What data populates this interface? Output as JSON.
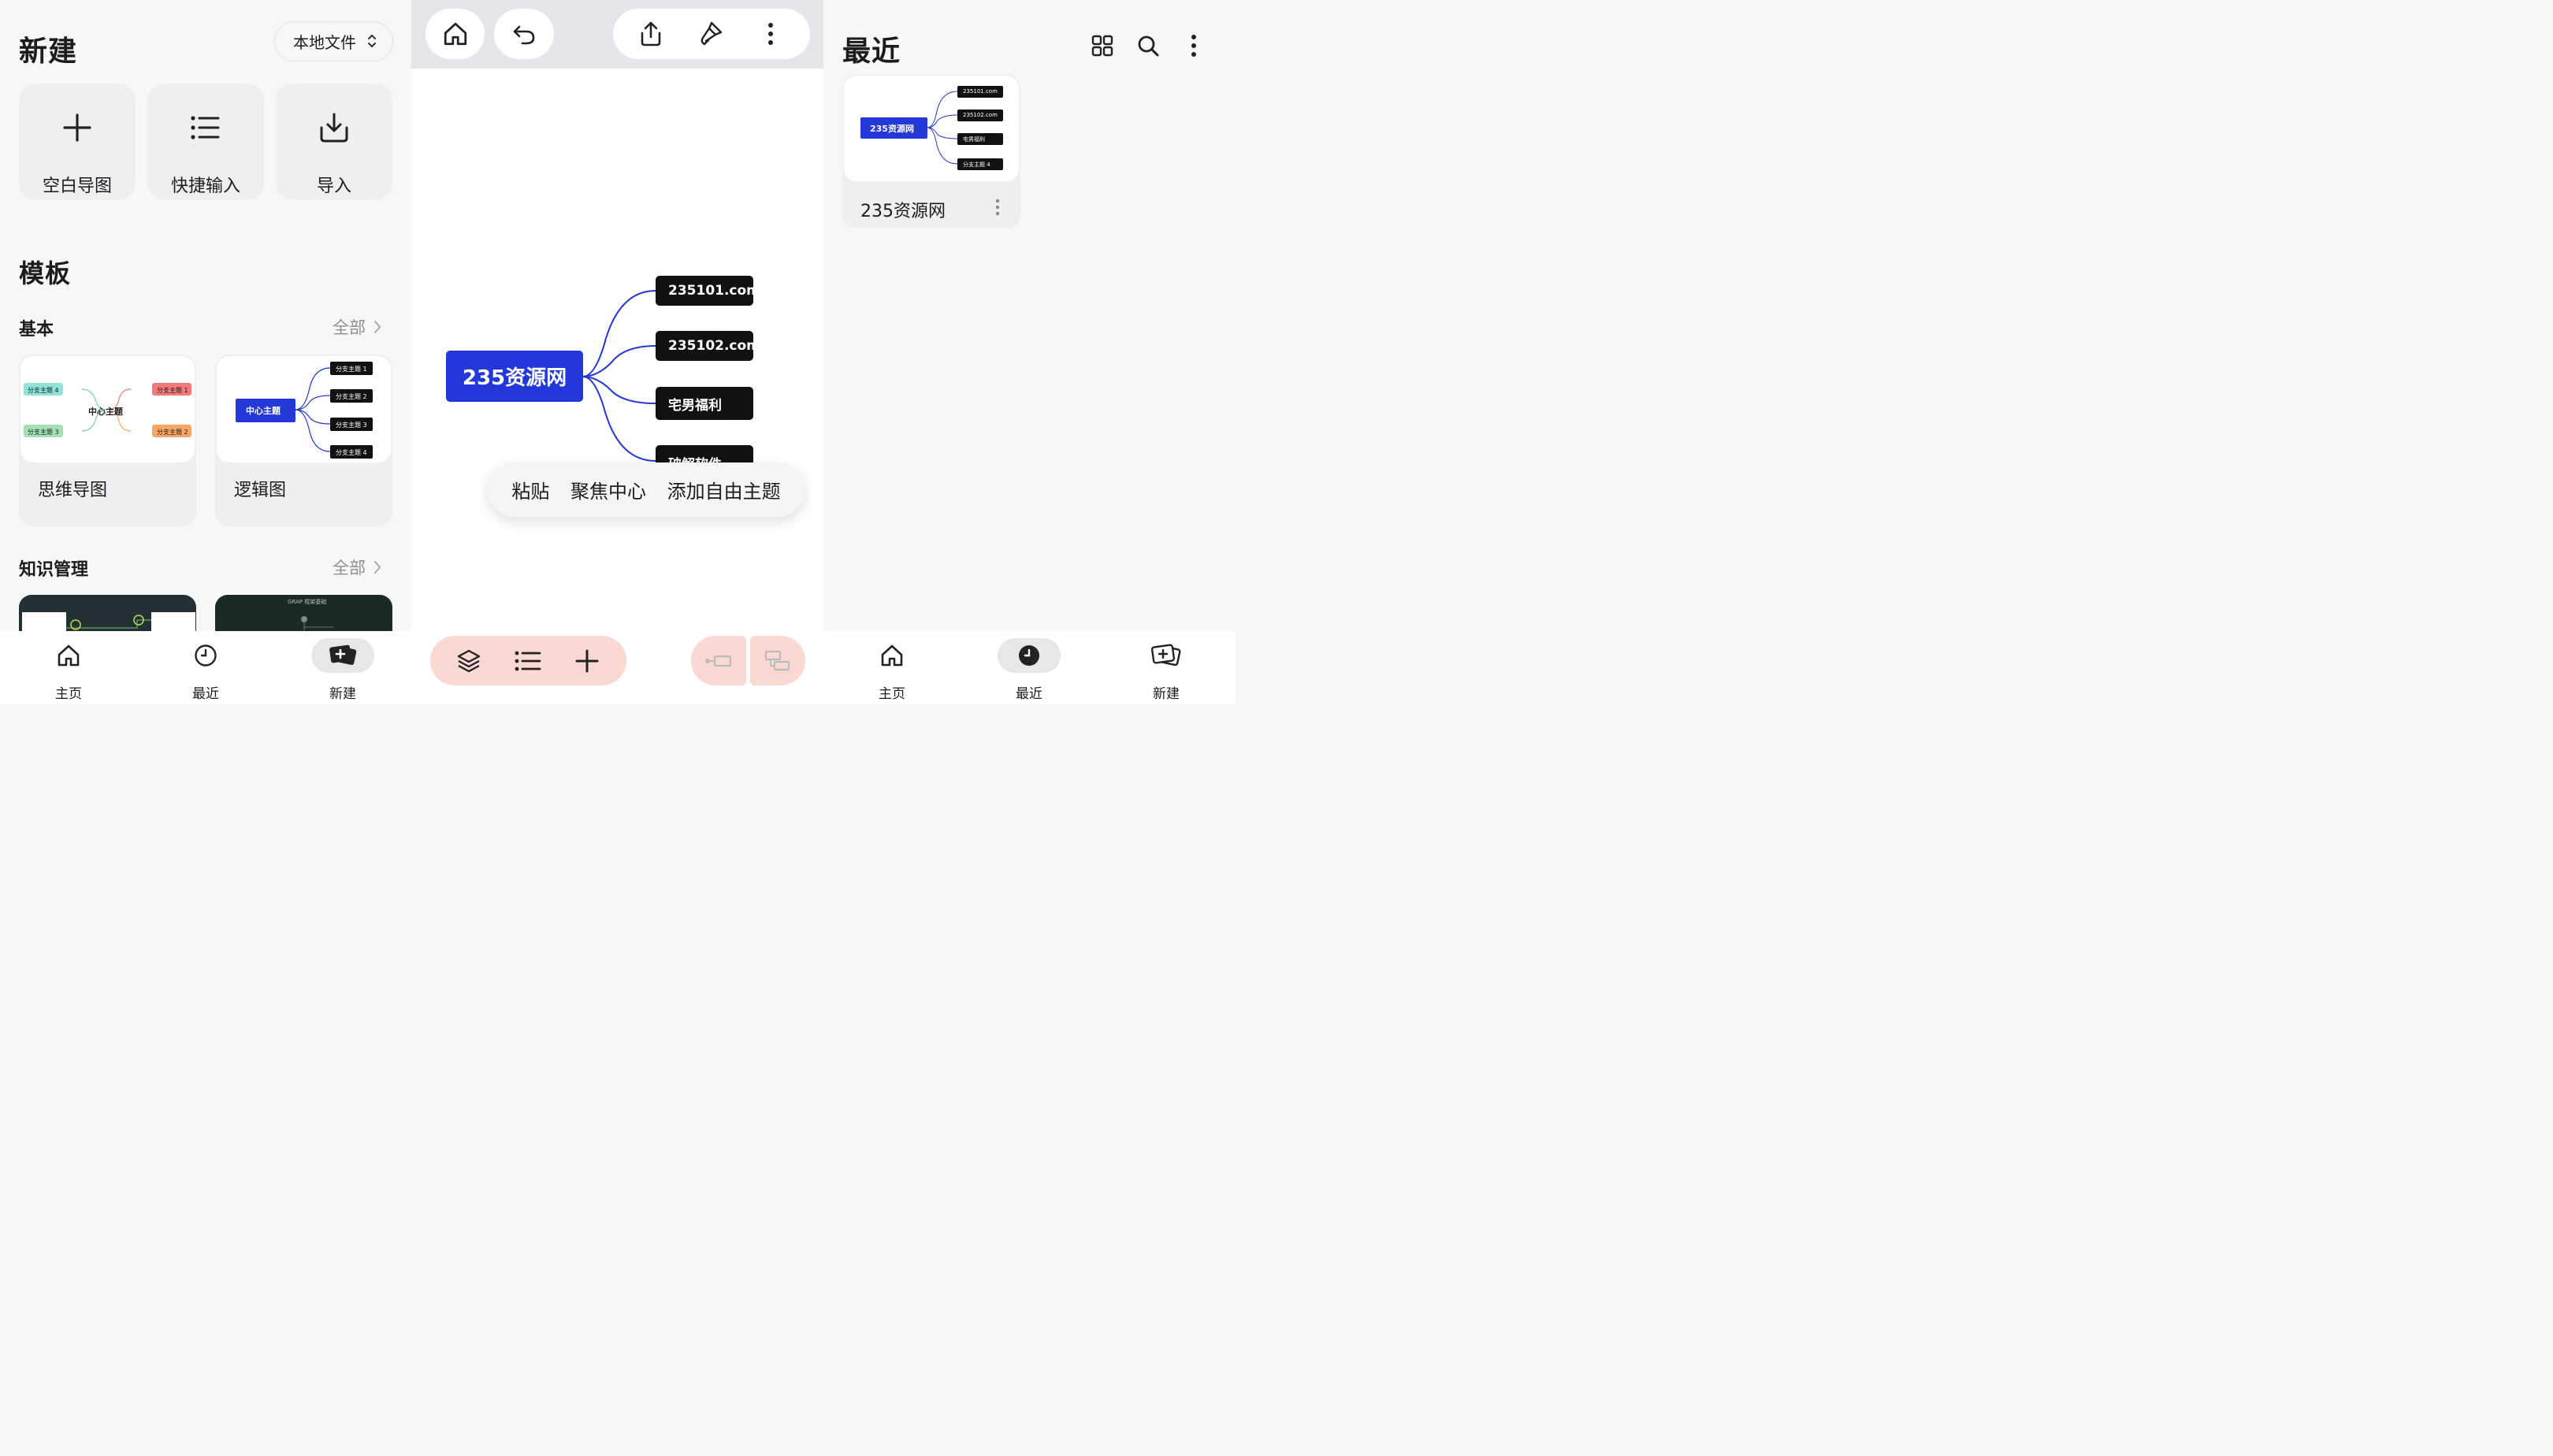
{
  "left_panel": {
    "new_title": "新建",
    "source_selector": "本地文件",
    "quick_actions": [
      {
        "label": "空白导图",
        "icon": "plus-icon"
      },
      {
        "label": "快捷输入",
        "icon": "list-icon"
      },
      {
        "label": "导入",
        "icon": "download-icon"
      }
    ],
    "templates_title": "模板",
    "basic_section": "基本",
    "see_all": "全部",
    "basic_templates": [
      {
        "label": "思维导图",
        "center": "中心主题",
        "branches": [
          "分支主题 1",
          "分支主题 2",
          "分支主题 3",
          "分支主题 4"
        ]
      },
      {
        "label": "逻辑图",
        "center": "中心主题",
        "branches": [
          "分支主题 1",
          "分支主题 2",
          "分支主题 3",
          "分支主题 4"
        ]
      }
    ],
    "knowledge_section": "知识管理",
    "knowledge_templates": [
      {
        "preview": "dark-template-1"
      },
      {
        "preview": "GRAP 框架基础"
      }
    ]
  },
  "editor_panel": {
    "toolbar_icons": [
      "home-icon",
      "undo-icon",
      "share-icon",
      "brush-icon",
      "more-icon"
    ],
    "mindmap": {
      "root": "235资源网",
      "children": [
        "235101.com",
        "235102.com",
        "宅男福利",
        "破解软件"
      ]
    },
    "context_menu": [
      "粘贴",
      "聚焦中心",
      "添加自由主题"
    ],
    "bottom_icons": [
      "layers-icon",
      "list-icon",
      "plus-icon",
      "sibling-topic-icon",
      "subtopic-icon"
    ]
  },
  "recent_panel": {
    "title": "最近",
    "header_icons": [
      "grid-view-icon",
      "search-icon",
      "more-icon"
    ],
    "files": [
      {
        "name": "235资源网",
        "root": "235资源网",
        "children": [
          "235101.com",
          "235102.com",
          "宅男福利",
          "分支主题 4"
        ]
      }
    ]
  },
  "nav": {
    "items": [
      "主页",
      "最近",
      "新建"
    ]
  },
  "colors": {
    "accent_blue": "#2238d9",
    "node_black": "#111111",
    "bottom_pill": "#f9d9d2"
  }
}
